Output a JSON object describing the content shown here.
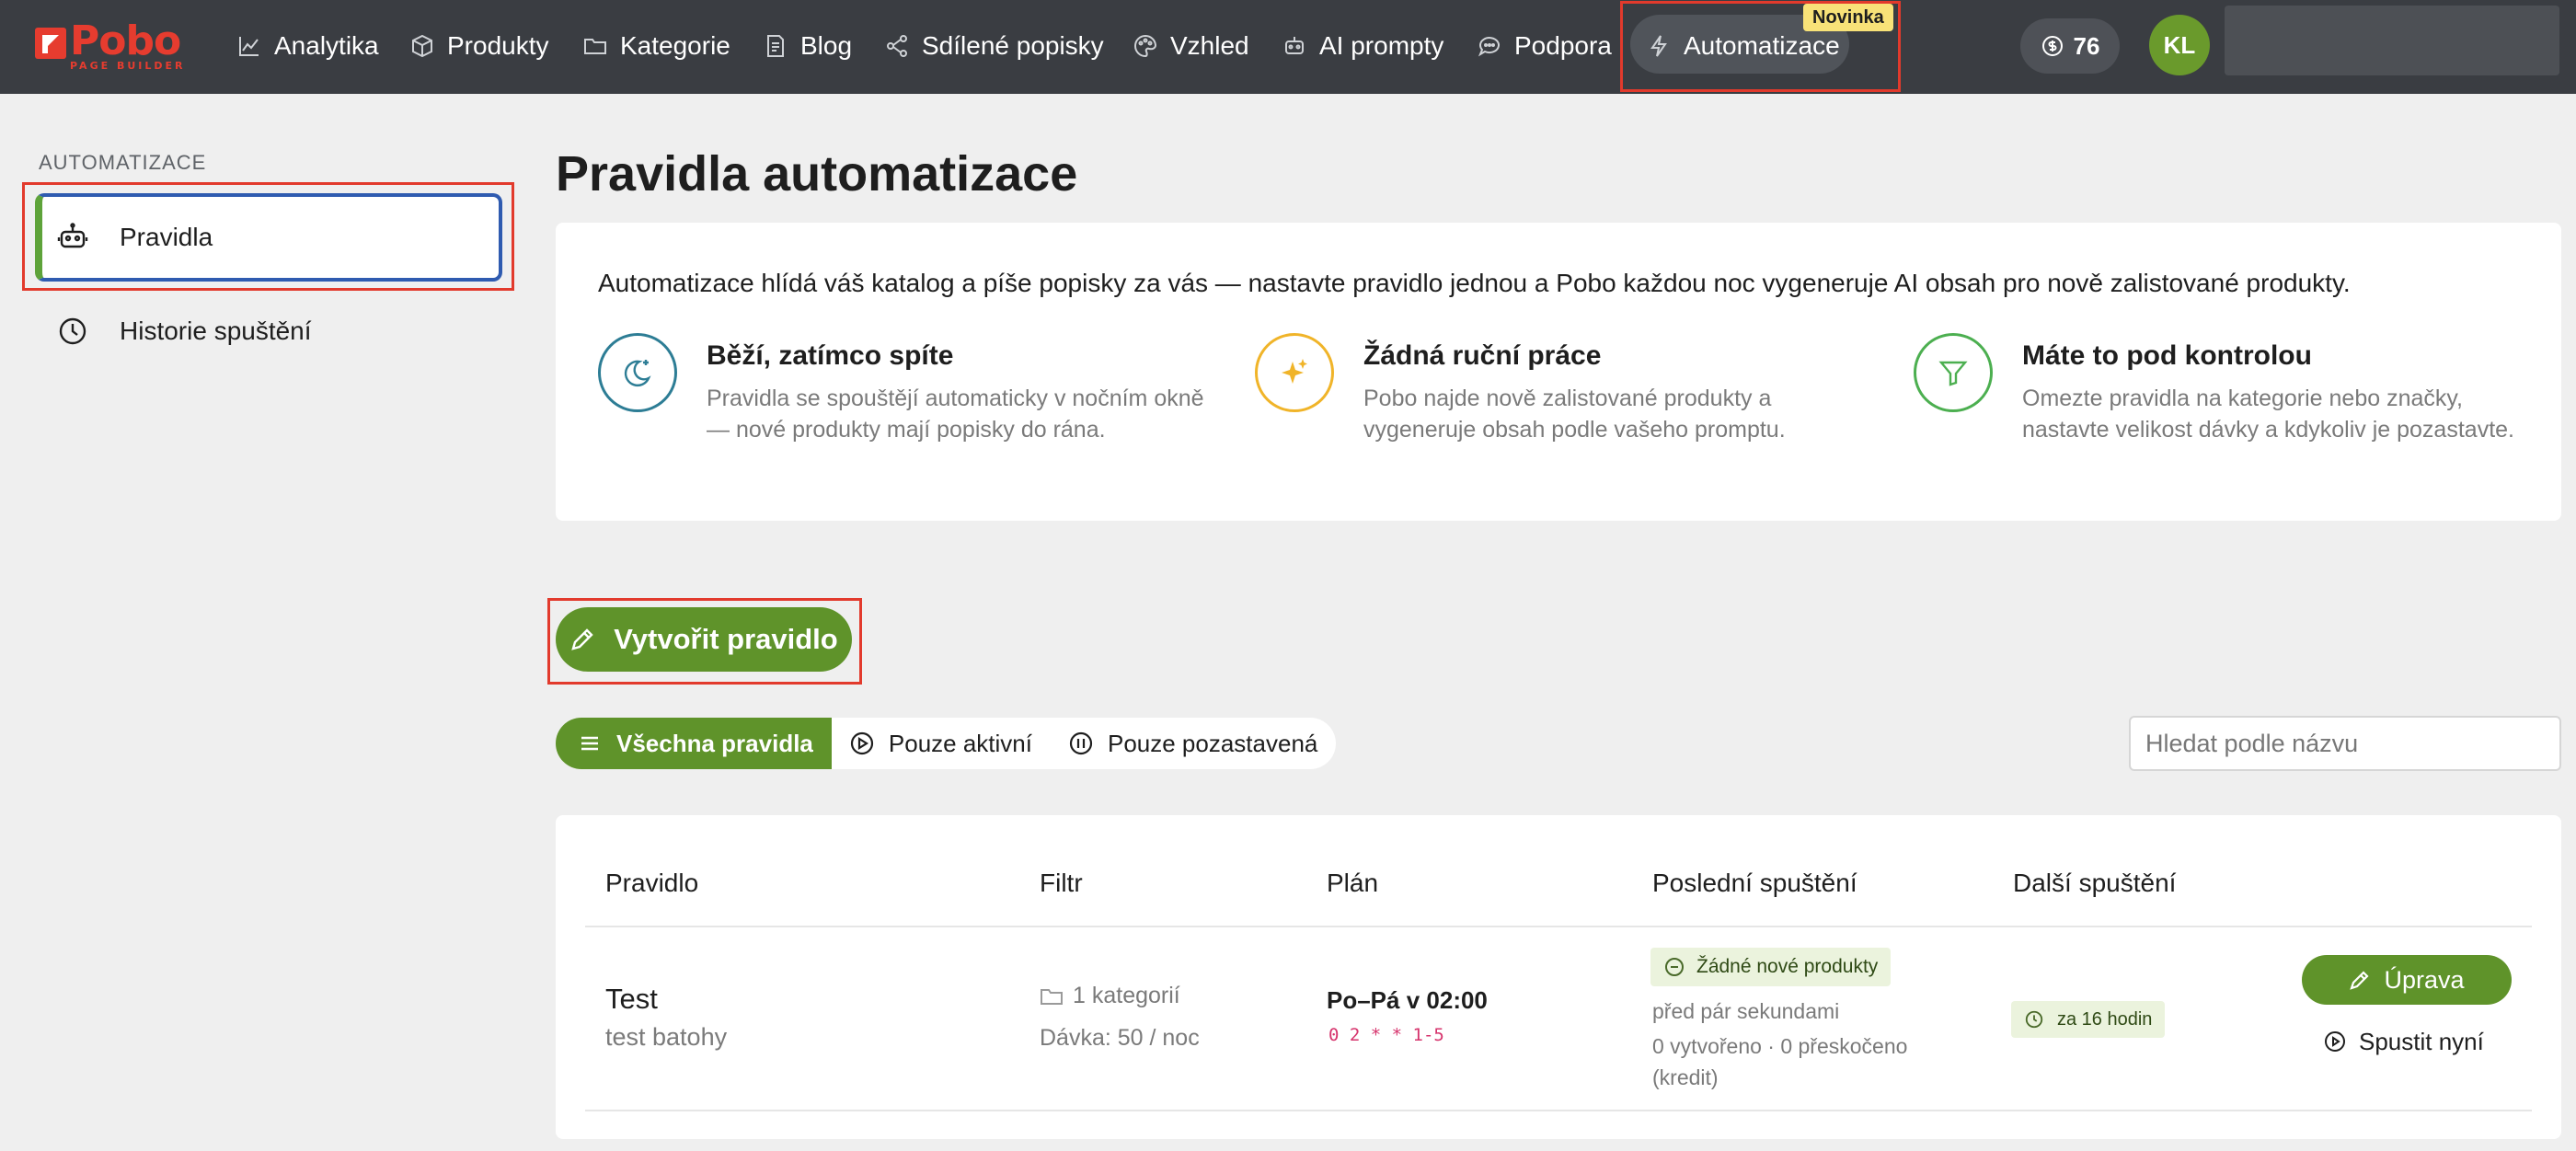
{
  "brand": {
    "name": "Pobo",
    "subtitle": "PAGE BUILDER"
  },
  "nav": {
    "items": [
      {
        "label": "Analytika",
        "icon": "chart-line-icon"
      },
      {
        "label": "Produkty",
        "icon": "box-icon"
      },
      {
        "label": "Kategorie",
        "icon": "folder-icon"
      },
      {
        "label": "Blog",
        "icon": "document-icon"
      },
      {
        "label": "Sdílené popisky",
        "icon": "share-icon"
      },
      {
        "label": "Vzhled",
        "icon": "palette-icon"
      },
      {
        "label": "AI prompty",
        "icon": "robot-icon"
      },
      {
        "label": "Podpora",
        "icon": "chat-icon"
      },
      {
        "label": "Automatizace",
        "icon": "bolt-icon",
        "active": true
      }
    ],
    "new_badge": "Novinka",
    "credits": "76",
    "avatar_initials": "KL"
  },
  "sidebar": {
    "heading": "AUTOMATIZACE",
    "items": [
      {
        "label": "Pravidla",
        "icon": "robot-icon",
        "active": true
      },
      {
        "label": "Historie spuštění",
        "icon": "clock-icon"
      }
    ]
  },
  "page": {
    "title": "Pravidla automatizace",
    "intro": "Automatizace hlídá váš katalog a píše popisky za vás — nastavte pravidlo jednou a Pobo každou noc vygeneruje AI obsah pro nově zalistované produkty.",
    "features": [
      {
        "title": "Běží, zatímco spíte",
        "text": "Pravidla se spouštějí automaticky v nočním okně — nové produkty mají popisky do rána.",
        "icon": "moon-icon",
        "color": "#2d7d95"
      },
      {
        "title": "Žádná ruční práce",
        "text": "Pobo najde nově zalistované produkty a vygeneruje obsah podle vašeho promptu.",
        "icon": "sparkles-icon",
        "color": "#f0b429"
      },
      {
        "title": "Máte to pod kontrolou",
        "text": "Omezte pravidla na kategorie nebo značky, nastavte velikost dávky a kdykoliv je pozastavte.",
        "icon": "filter-icon",
        "color": "#4caf50"
      }
    ],
    "create_button": "Vytvořit pravidlo",
    "filters": [
      {
        "label": "Všechna pravidla",
        "active": true
      },
      {
        "label": "Pouze aktivní"
      },
      {
        "label": "Pouze pozastavená"
      }
    ],
    "search_placeholder": "Hledat podle názvu"
  },
  "table": {
    "headers": [
      "Pravidlo",
      "Filtr",
      "Plán",
      "Poslední spuštění",
      "Další spuštění"
    ],
    "rows": [
      {
        "name": "Test",
        "description": "test batohy",
        "filter_categories": "1 kategorií",
        "filter_batch": "Dávka: 50 / noc",
        "plan": "Po–Pá v 02:00",
        "cron": "0 2 * * 1-5",
        "last_status": "Žádné nové produkty",
        "last_time": "před pár sekundami",
        "last_stats": "0 vytvořeno · 0 přeskočeno (kredit)",
        "next_run": "za 16 hodin",
        "edit_label": "Úprava",
        "run_label": "Spustit nyní"
      }
    ]
  },
  "colors": {
    "accent": "#5f932a",
    "topbar": "#3a3d42",
    "brand": "#e63c2f"
  }
}
